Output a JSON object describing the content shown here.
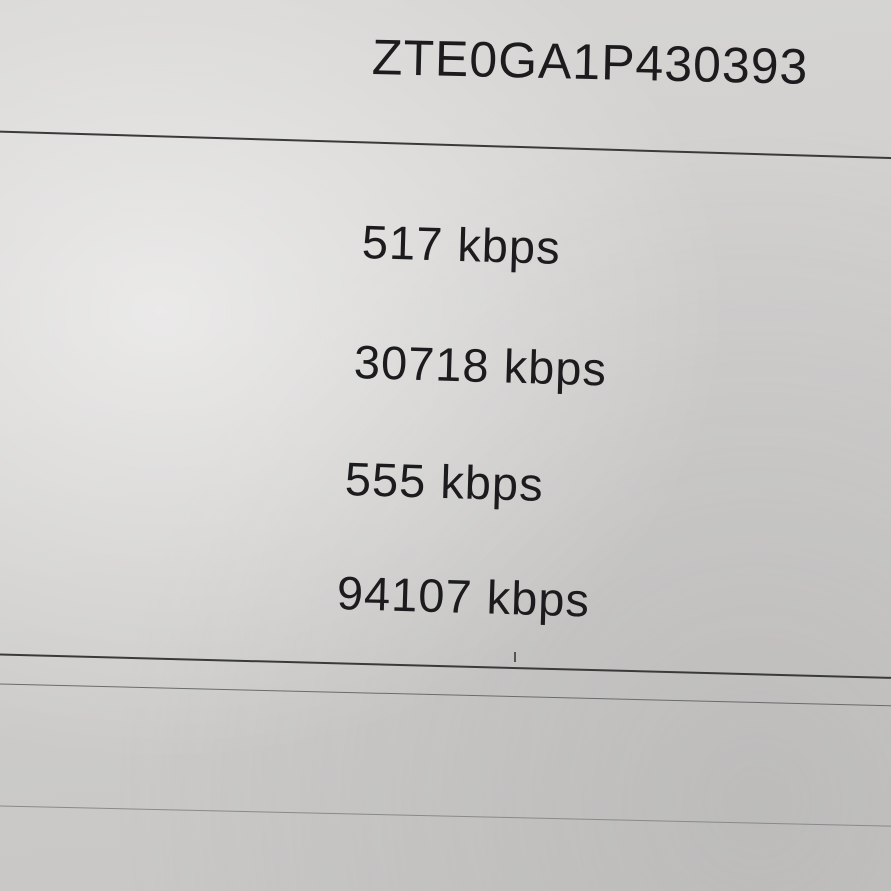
{
  "device": {
    "serial_number": "ZTE0GA1P430393"
  },
  "line_rates": [
    {
      "value": "517 kbps"
    },
    {
      "value": "30718 kbps"
    },
    {
      "value": "555 kbps"
    },
    {
      "value": "94107 kbps"
    }
  ]
}
